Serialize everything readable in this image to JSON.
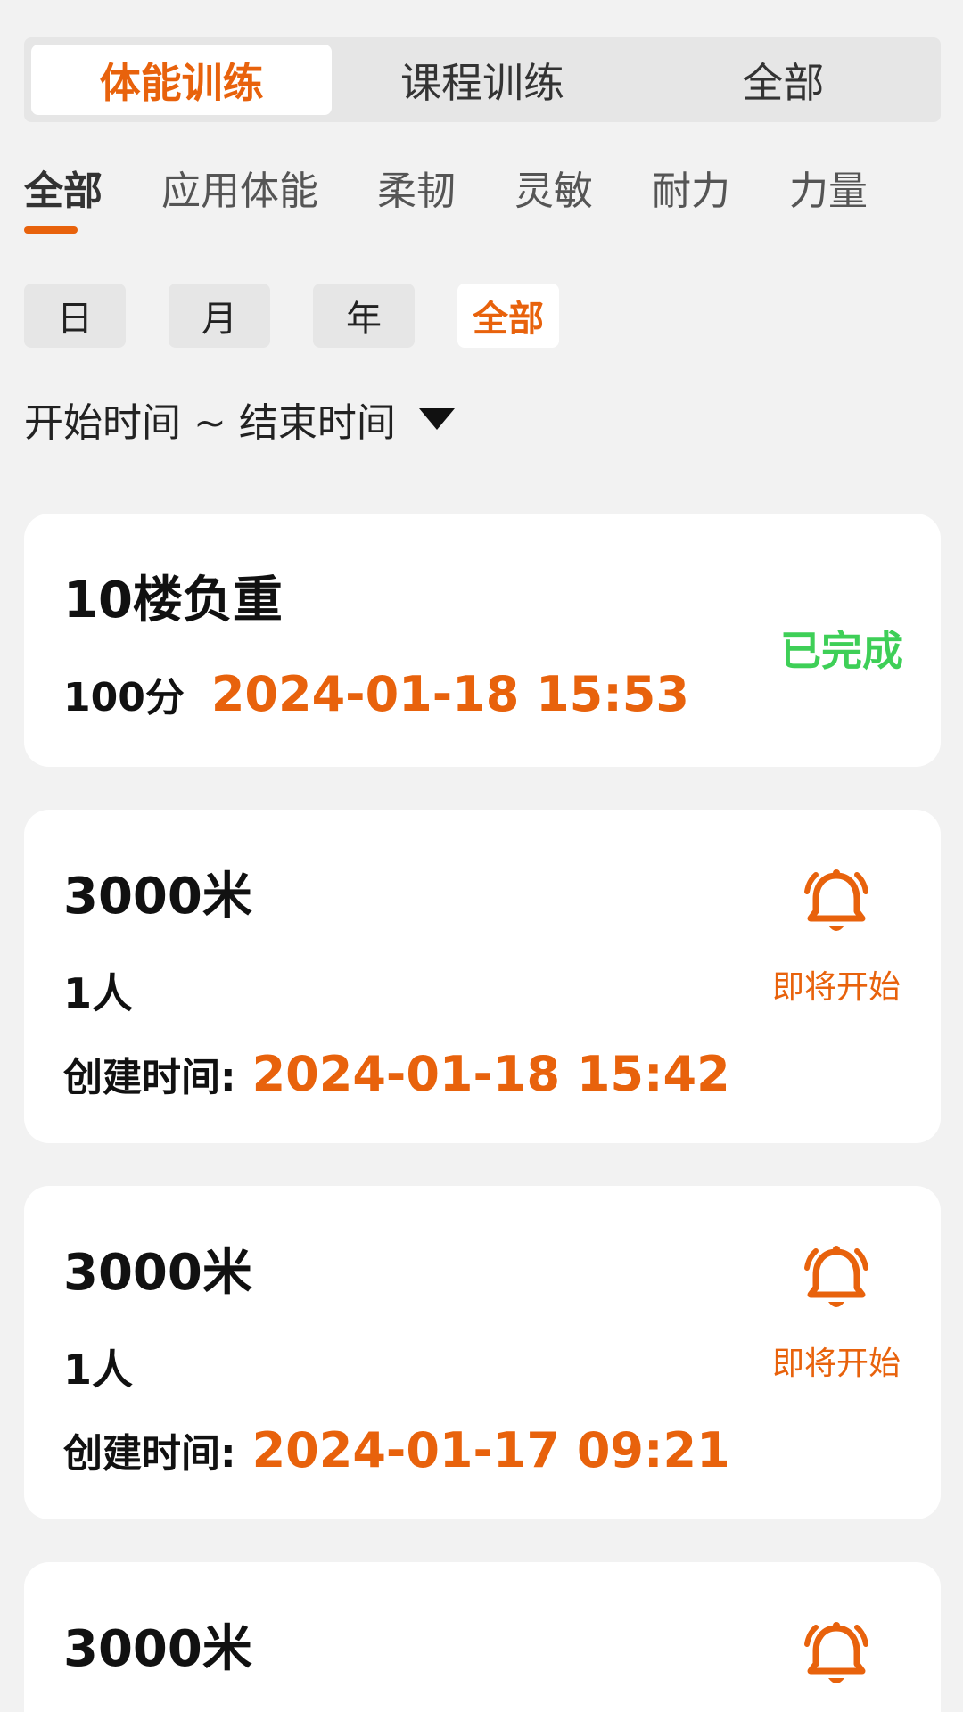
{
  "seg_tabs": [
    {
      "label": "体能训练",
      "active": true
    },
    {
      "label": "课程训练",
      "active": false
    },
    {
      "label": "全部",
      "active": false
    }
  ],
  "category_tabs": [
    {
      "label": "全部",
      "active": true
    },
    {
      "label": "应用体能",
      "active": false
    },
    {
      "label": "柔韧",
      "active": false
    },
    {
      "label": "灵敏",
      "active": false
    },
    {
      "label": "耐力",
      "active": false
    },
    {
      "label": "力量",
      "active": false
    }
  ],
  "period_chips": [
    {
      "label": "日",
      "active": false
    },
    {
      "label": "月",
      "active": false
    },
    {
      "label": "年",
      "active": false
    },
    {
      "label": "全部",
      "active": true
    }
  ],
  "date_range": {
    "label": "开始时间 ~ 结束时间",
    "icon": "caret-down-icon"
  },
  "cards": [
    {
      "title": "10楼负重",
      "score": "100分",
      "date": "2024-01-18 15:53",
      "status": "已完成"
    },
    {
      "title": "3000米",
      "count": "1人",
      "created_label": "创建时间:",
      "date": "2024-01-18 15:42",
      "status": "即将开始",
      "icon": "bell-icon"
    },
    {
      "title": "3000米",
      "count": "1人",
      "created_label": "创建时间:",
      "date": "2024-01-17 09:21",
      "status": "即将开始",
      "icon": "bell-icon"
    },
    {
      "title": "3000米",
      "icon": "bell-icon"
    }
  ],
  "colors": {
    "accent": "#e8620c",
    "done": "#3ecf57",
    "background": "#f2f2f2"
  }
}
